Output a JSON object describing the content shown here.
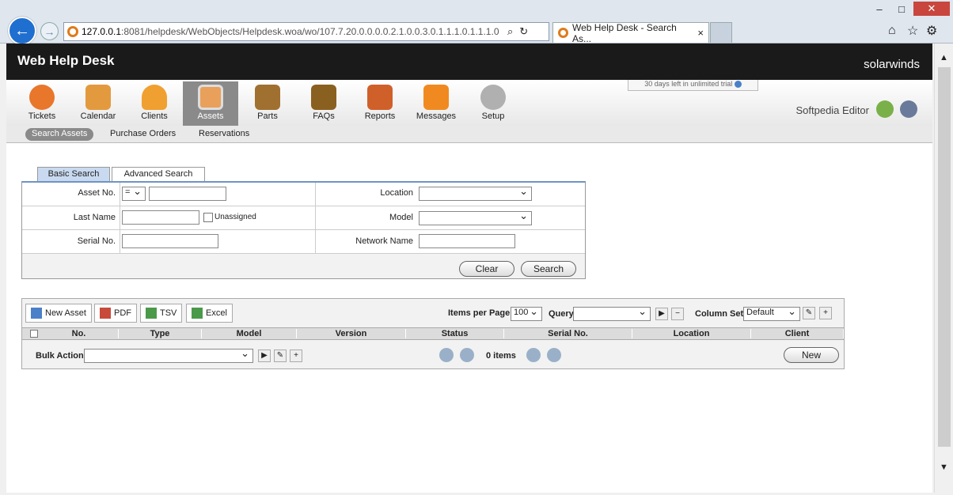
{
  "browser": {
    "url_host": "127.0.0.1",
    "url_rest": ":8081/helpdesk/WebObjects/Helpdesk.woa/wo/107.7.20.0.0.0.0.2.1.0.0.3.0.1.1.1.0.1.1.1.0",
    "tab_title": "Web Help Desk - Search As...",
    "close_glyph": "×"
  },
  "header": {
    "title": "Web Help Desk",
    "logo": "solarwinds"
  },
  "modules": [
    {
      "label": "Tickets",
      "color": "#e8762b"
    },
    {
      "label": "Calendar",
      "color": "#e39a3e"
    },
    {
      "label": "Clients",
      "color": "#f0a030"
    },
    {
      "label": "Assets",
      "color": "#e8a05a"
    },
    {
      "label": "Parts",
      "color": "#a07030"
    },
    {
      "label": "FAQs",
      "color": "#8a6020"
    },
    {
      "label": "Reports",
      "color": "#d0602a"
    },
    {
      "label": "Messages",
      "color": "#f08a20"
    },
    {
      "label": "Setup",
      "color": "#b0b0b0"
    }
  ],
  "trial": "30 days left in unlimited trial",
  "user": "Softpedia Editor",
  "subnav": [
    "Search Assets",
    "Purchase Orders",
    "Reservations"
  ],
  "search": {
    "tabs": [
      "Basic Search",
      "Advanced Search"
    ],
    "asset_no": "Asset No.",
    "asset_op": "=",
    "last_name": "Last Name",
    "unassigned": "Unassigned",
    "serial_no": "Serial No.",
    "location": "Location",
    "model": "Model",
    "network_name": "Network Name",
    "clear": "Clear",
    "search": "Search"
  },
  "results": {
    "new_asset": "New Asset",
    "pdf": "PDF",
    "tsv": "TSV",
    "excel": "Excel",
    "items_per_page_label": "Items per Page",
    "items_per_page": "100",
    "query": "Query",
    "column_set": "Column Set",
    "column_set_value": "Default",
    "columns": [
      "No.",
      "Type",
      "Model",
      "Version",
      "Status",
      "Serial No.",
      "Location",
      "Client"
    ],
    "bulk_action": "Bulk Action",
    "items": "0 items",
    "new": "New"
  }
}
